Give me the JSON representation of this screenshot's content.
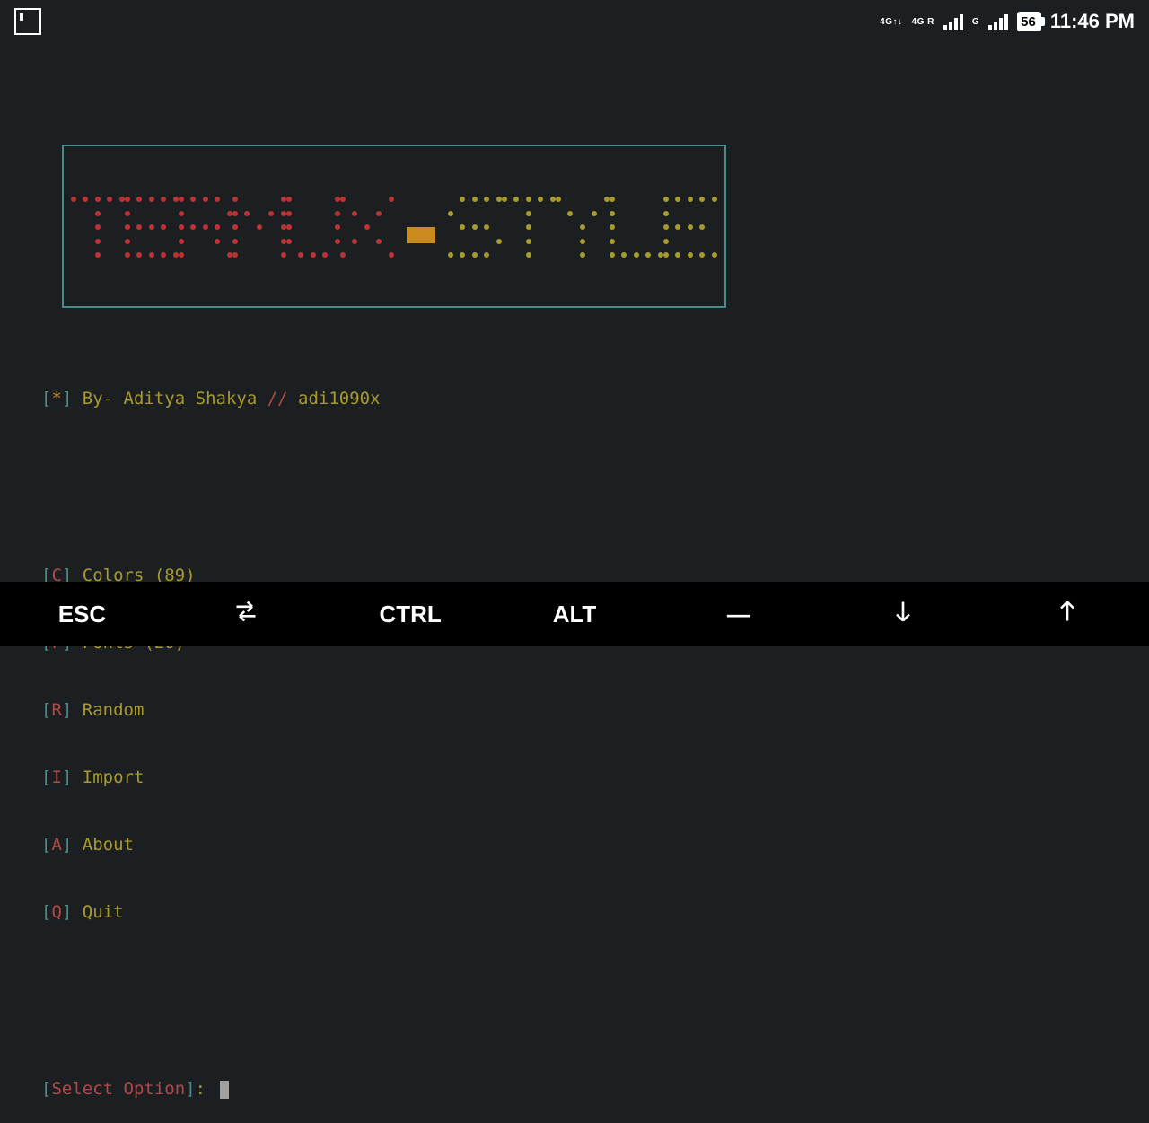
{
  "statusbar": {
    "network1_label": "4G↑↓",
    "network2_label": "4G R",
    "network3_label": "G",
    "battery_pct": "56",
    "clock": "11:46 PM"
  },
  "banner": {
    "text": "TERMUX-STYLE"
  },
  "byline": {
    "bracket_open": "[",
    "star": "*",
    "bracket_close": "]",
    "by_label": " By- Aditya Shakya ",
    "slashes": "// ",
    "handle": "adi1090x"
  },
  "menu": [
    {
      "key": "C",
      "label": " Colors (89)"
    },
    {
      "key": "F",
      "label": " Fonts (20)"
    },
    {
      "key": "R",
      "label": " Random"
    },
    {
      "key": "I",
      "label": " Import"
    },
    {
      "key": "A",
      "label": " About"
    },
    {
      "key": "Q",
      "label": " Quit"
    }
  ],
  "prompt": {
    "bracket_open": "[",
    "text": "Select Option",
    "bracket_close": "]",
    "colon": ": "
  },
  "keyrow": {
    "esc": "ESC",
    "ctrl": "CTRL",
    "alt": "ALT",
    "dash": "—"
  }
}
